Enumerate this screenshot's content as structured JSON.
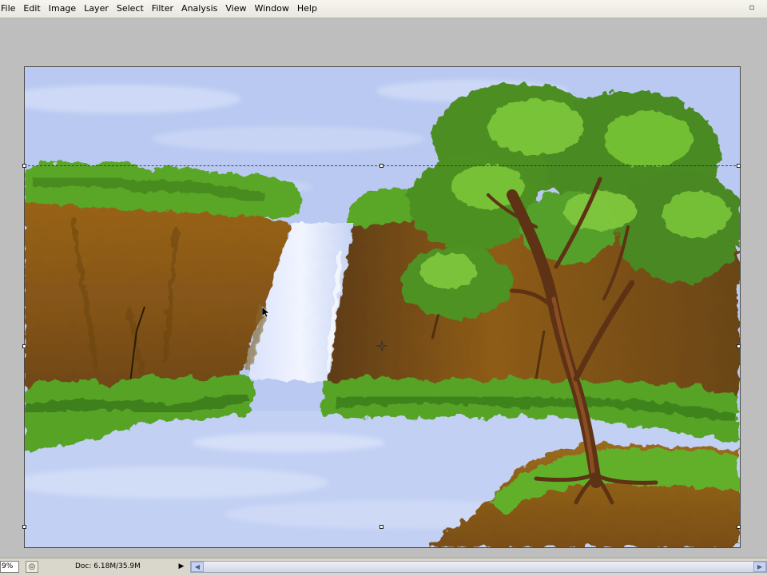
{
  "menu": {
    "items": [
      {
        "label": "File",
        "name": "menu-file"
      },
      {
        "label": "Edit",
        "name": "menu-edit"
      },
      {
        "label": "Image",
        "name": "menu-image"
      },
      {
        "label": "Layer",
        "name": "menu-layer"
      },
      {
        "label": "Select",
        "name": "menu-select"
      },
      {
        "label": "Filter",
        "name": "menu-filter"
      },
      {
        "label": "Analysis",
        "name": "menu-analysis"
      },
      {
        "label": "View",
        "name": "menu-view"
      },
      {
        "label": "Window",
        "name": "menu-window"
      },
      {
        "label": "Help",
        "name": "menu-help"
      }
    ],
    "window_control_glyph": "▫"
  },
  "status": {
    "zoom": "9%",
    "doc_info": "Doc: 6.18M/35.9M",
    "arrow_glyph": "▶",
    "scroll_left_glyph": "◀",
    "scroll_right_glyph": "▶"
  },
  "colors": {
    "sky": "#b8c8f0",
    "cliff": "#8a5a16",
    "foliage": "#5fae2a",
    "water": "#c4d2f4",
    "trunk": "#6b3a18"
  },
  "icons": {
    "status_icon": "document-status-icon"
  }
}
